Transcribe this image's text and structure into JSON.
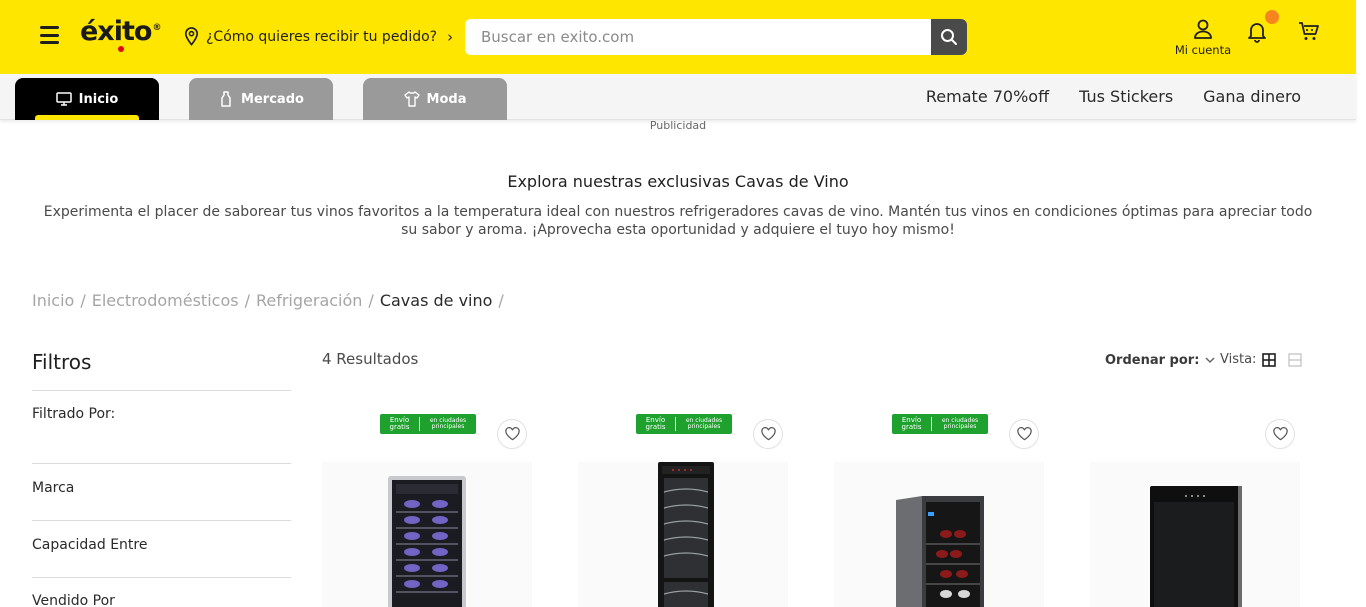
{
  "header": {
    "logo_text": "éxito",
    "logo_reg": "®",
    "delivery_prompt": "¿Cómo quieres recibir tu pedido?",
    "search_placeholder": "Buscar en exito.com",
    "account_label": "Mi cuenta",
    "brand_color": "#ffe600",
    "notification_dot_color": "#f7851e"
  },
  "category_tabs": [
    {
      "label": "Inicio",
      "icon": "monitor-icon",
      "active": true
    },
    {
      "label": "Mercado",
      "icon": "bottle-icon",
      "active": false
    },
    {
      "label": "Moda",
      "icon": "shirt-icon",
      "active": false
    }
  ],
  "top_links": [
    "Remate 70%off",
    "Tus Stickers",
    "Gana dinero"
  ],
  "ad_label": "Publicidad",
  "promo": {
    "title": "Explora nuestras exclusivas Cavas de Vino",
    "text": "Experimenta el placer de saborear tus vinos favoritos a la temperatura ideal con nuestros refrigeradores cavas de vino. Mantén tus vinos en condiciones óptimas para apreciar todo su sabor y aroma. ¡Aprovecha esta oportunidad y adquiere el tuyo hoy mismo!"
  },
  "breadcrumb": {
    "items": [
      "Inicio",
      "Electrodomésticos",
      "Refrigeración"
    ],
    "current": "Cavas de vino",
    "separator": "/"
  },
  "filters": {
    "title": "Filtros",
    "filtered_by": "Filtrado Por:",
    "groups": [
      "Marca",
      "Capacidad Entre",
      "Vendido Por"
    ]
  },
  "results": {
    "count_text": "4 Resultados",
    "sort_label": "Ordenar por:",
    "view_label": "Vista:"
  },
  "products": [
    {
      "free_shipping": true,
      "badge_left": "Envío gratis",
      "badge_right": "en ciudades principales",
      "image": "wine-cooler-tall-glass"
    },
    {
      "free_shipping": true,
      "badge_left": "Envío gratis",
      "badge_right": "en ciudades principales",
      "image": "wine-cooler-slim-black"
    },
    {
      "free_shipping": true,
      "badge_left": "Envío gratis",
      "badge_right": "en ciudades principales",
      "image": "wine-cooler-compact"
    },
    {
      "free_shipping": false,
      "image": "wine-cooler-black-door"
    }
  ]
}
